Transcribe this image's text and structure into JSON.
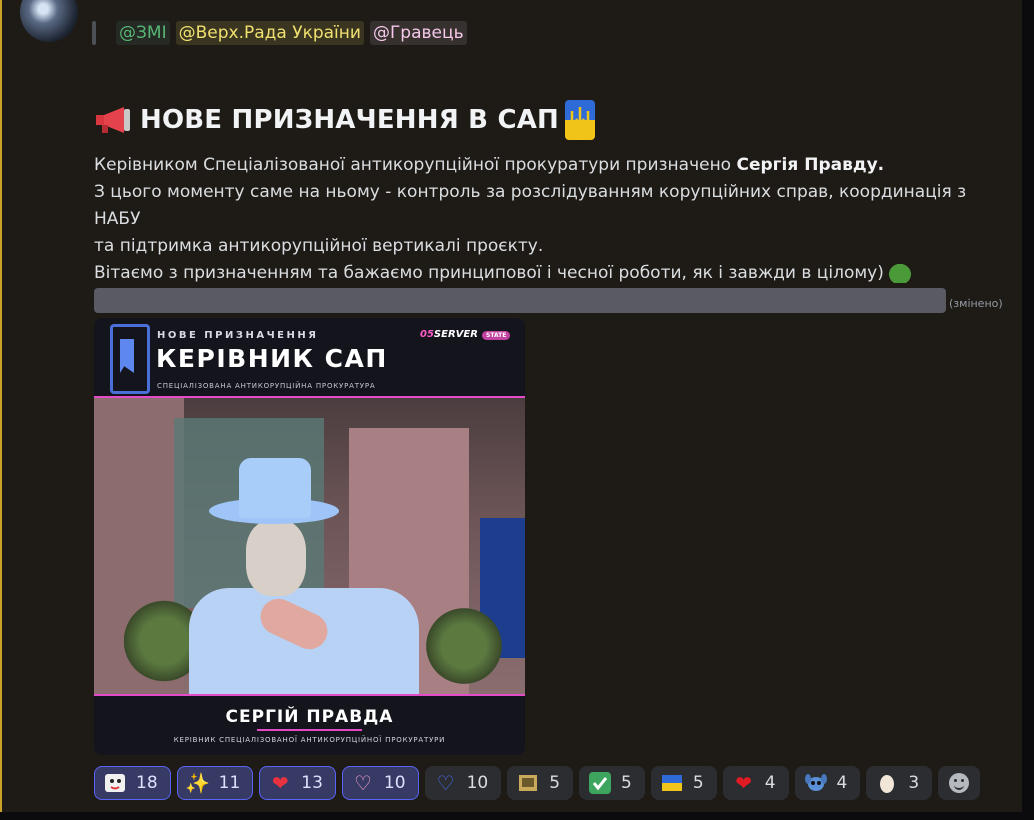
{
  "message": {
    "title": "НОВЕ ПРИЗНАЧЕННЯ В САП",
    "mentions": [
      "@ЗМІ",
      "@Верх.Рада України",
      "@Гравець"
    ],
    "body": {
      "line1_start": "Керівником Спеціалізованої антикорупційної прокуратури призначено ",
      "line1_bold": "Сергія Правду.",
      "line2": "З цього моменту саме на ньому - контроль за розслідуванням корупційних справ, координація з НАБУ",
      "line3": "та підтримка антикорупційної вертикалі проєкту.",
      "line4": "Вітаємо з призначенням та бажаємо принципової і чесної роботи, як і завжди в цілому)"
    },
    "edited_label": "(змінено)"
  },
  "image": {
    "small_title": "НОВЕ ПРИЗНАЧЕННЯ",
    "big_title": "КЕРІВНИК САП",
    "subtitle": "СПЕЦІАЛІЗОВАНА АНТИКОРУПЦІЙНА ПРОКУРАТУРА",
    "server_num": "05",
    "server_word": "SERVER",
    "state": "STATE",
    "name": "СЕРГІЙ ПРАВДА",
    "name_sub": "КЕРІВНИК СПЕЦІАЛІЗОВАНОЇ АНТИКОРУПЦІЙНОЇ ПРОКУРАТУРИ"
  },
  "reactions": [
    {
      "icon": "sticker-emoji",
      "count": "18",
      "active": true
    },
    {
      "icon": "sparkles",
      "count": "11",
      "active": true
    },
    {
      "icon": "red-heart",
      "count": "13",
      "active": true
    },
    {
      "icon": "pink-heart-outline",
      "count": "10",
      "active": true
    },
    {
      "icon": "blue-heart-outline",
      "count": "10",
      "active": false
    },
    {
      "icon": "custom-emoji",
      "count": "5",
      "active": false
    },
    {
      "icon": "check-mark",
      "count": "5",
      "active": false
    },
    {
      "icon": "ukraine-emoji",
      "count": "5",
      "active": false
    },
    {
      "icon": "pixel-heart",
      "count": "4",
      "active": false
    },
    {
      "icon": "stitch-emoji",
      "count": "4",
      "active": false
    },
    {
      "icon": "egg",
      "count": "3",
      "active": false
    }
  ],
  "colors": {
    "accent": "#5865f2",
    "highlight_border": "#c9a227",
    "pink": "#e24cc8"
  }
}
